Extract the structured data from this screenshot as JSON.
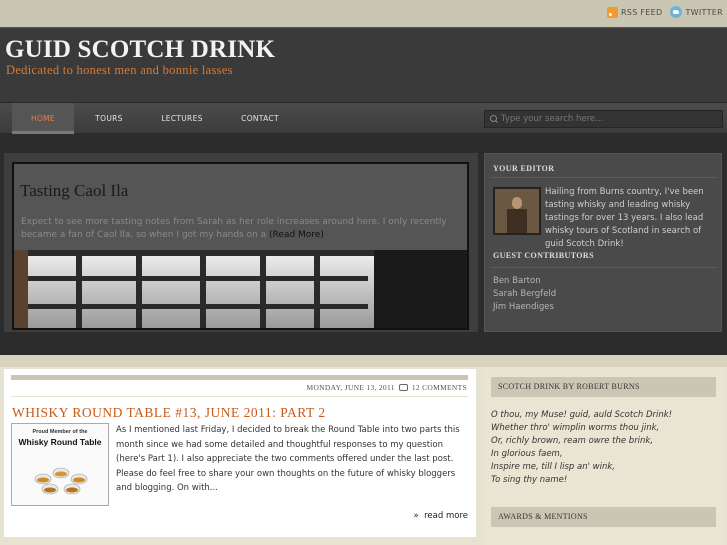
{
  "topbar": {
    "rss_label": "RSS FEED",
    "twitter_label": "TWITTER"
  },
  "header": {
    "title": "GUID SCOTCH DRINK",
    "tagline": "Dedicated to honest men and bonnie lasses"
  },
  "nav": {
    "items": [
      "HOME",
      "TOURS",
      "LECTURES",
      "CONTACT"
    ],
    "active": "HOME",
    "search_placeholder": "Type your search here..."
  },
  "featured": {
    "title": "Tasting Caol Ila",
    "excerpt": "Expect to see more tasting notes from Sarah as her role increases around here. I only recently became a fan of Caol Ila, so when I got my hands on a",
    "more_label": "(Read More)"
  },
  "editor": {
    "heading": "YOUR EDITOR",
    "bio": "Hailing from Burns country, I've been tasting whisky and leading whisky tastings for over 13 years. I also lead whisky tours of Scotland in search of guid Scotch Drink!"
  },
  "guests": {
    "heading": "GUEST CONTRIBUTORS",
    "names": [
      "Ben Barton",
      "Sarah Bergfeld",
      "Jim Haendiges"
    ]
  },
  "post": {
    "date": "MONDAY, JUNE 13, 2011",
    "comments": "12 COMMENTS",
    "title": "WHISKY ROUND TABLE #13, JUNE 2011: PART 2",
    "badge_line1": "Proud Member of the",
    "badge_line2": "Whisky Round Table",
    "body": "As I mentioned last Friday, I decided to break the Round Table into two parts this month since we had some detailed and thoughtful responses to my question (here's Part 1).  I also appreciate the two comments offered under the last post. Please do feel free to share your own thoughts on the future of whisky bloggers and blogging. On with...",
    "read_more": "read more"
  },
  "sidebar": {
    "poem_heading": "SCOTCH DRINK BY ROBERT BURNS",
    "poem_lines": [
      "O thou, my Muse! guid, auld Scotch Drink!",
      "Whether thro' wimplin worms thou jink,",
      "Or, richly brown, ream owre the brink,",
      "In glorious faem,",
      "Inspire me, till I lisp an' wink,",
      "To sing thy name!"
    ],
    "awards_heading": "AWARDS & MENTIONS"
  },
  "colors": {
    "accent_orange": "#c85a19",
    "header_bg": "#3a3a3a",
    "tan": "#c9c7b3"
  }
}
